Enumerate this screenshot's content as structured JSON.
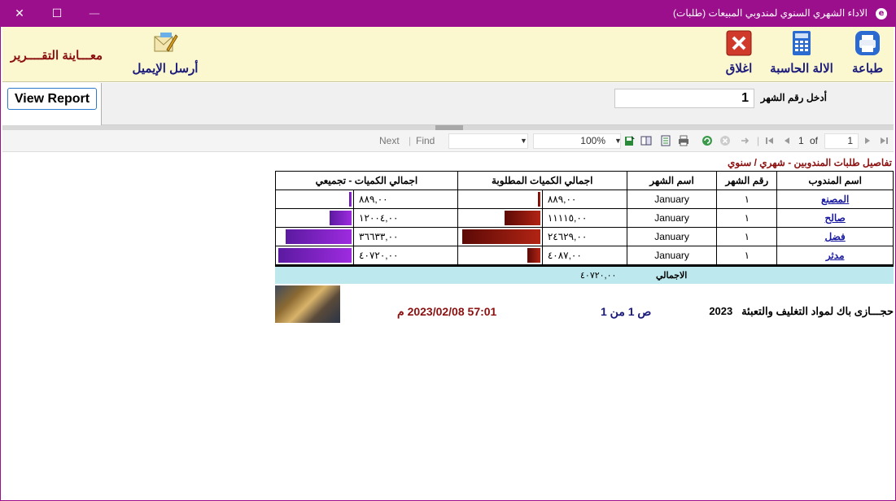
{
  "window": {
    "title": "الاداء الشهري السنوي لمندوبي المبيعات (طلبات)",
    "close_glyph": "✕",
    "maximize_glyph": "☐",
    "minimize_glyph": "—"
  },
  "toolbar": {
    "print_label": "طباعة",
    "calculator_label": "الالة الحاسبة",
    "close_label": "اغلاق",
    "email_label": "أرسل الإيميل",
    "preview_label": "معـــاينة التقــــرير"
  },
  "params": {
    "month_label": "أدخل رقم الشهر",
    "month_value": "1",
    "view_report": "View Report"
  },
  "viewer": {
    "next": "Next",
    "find": "Find",
    "zoom": "100%",
    "page_current": "1",
    "of": "of",
    "page_total": "1"
  },
  "report": {
    "title": "تفاصيل طلبات المندوبين - شهري / سنوي",
    "columns": [
      "اسم المندوب",
      "رقم الشهر",
      "اسم الشهر",
      "اجمالي الكميات المطلوبة",
      "اجمالي الكميات - تجميعي"
    ],
    "rows": [
      {
        "name": "المصنع",
        "month_no": "١",
        "month_name": "January",
        "qty": "٨٨٩,٠٠",
        "qty_fraction": 0.036,
        "cum": "٨٨٩,٠٠",
        "cum_fraction": 0.022
      },
      {
        "name": "صالح",
        "month_no": "١",
        "month_name": "January",
        "qty": "١١١١٥,٠٠",
        "qty_fraction": 0.454,
        "cum": "١٢٠٠٤,٠٠",
        "cum_fraction": 0.295
      },
      {
        "name": "فضل",
        "month_no": "١",
        "month_name": "January",
        "qty": "٢٤٦٢٩,٠٠",
        "qty_fraction": 1.0,
        "cum": "٣٦٦٣٣,٠٠",
        "cum_fraction": 0.9
      },
      {
        "name": "مدثر",
        "month_no": "١",
        "month_name": "January",
        "qty": "٤٠٨٧,٠٠",
        "qty_fraction": 0.166,
        "cum": "٤٠٧٢٠,٠٠",
        "cum_fraction": 1.0
      }
    ],
    "total_label": "الاجمالي",
    "total_value": "٤٠٧٢٠,٠٠",
    "company": "حجـــازى باك لمواد التغليف والتعبئة",
    "year": "2023",
    "page_of": "ص 1 من 1",
    "printed_at": "57:01 2023/02/08 م"
  },
  "colors": {
    "title_bar": "#9c0f8c",
    "toolbar_bg": "#fbf8d0",
    "header_red": "#8b1010",
    "total_bg": "#bde9ee"
  }
}
